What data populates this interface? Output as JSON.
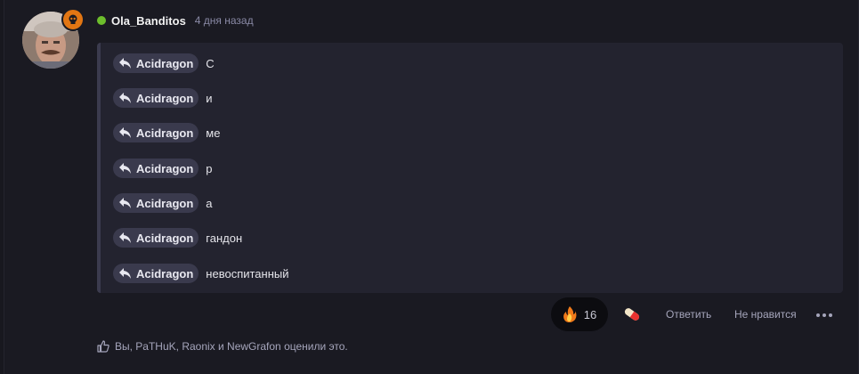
{
  "post": {
    "author": "Ola_Banditos",
    "timestamp": "4 дня назад",
    "online": true,
    "avatar_badge_icon": "skull-icon",
    "accent_badge_color": "#e27613",
    "online_color": "#6dbe2c",
    "quotes": [
      {
        "mention": "Acidragon",
        "text": "С"
      },
      {
        "mention": "Acidragon",
        "text": "и"
      },
      {
        "mention": "Acidragon",
        "text": "ме"
      },
      {
        "mention": "Acidragon",
        "text": "р"
      },
      {
        "mention": "Acidragon",
        "text": "а"
      },
      {
        "mention": "Acidragon",
        "text": "гандон"
      },
      {
        "mention": "Acidragon",
        "text": "невоспитанный"
      }
    ]
  },
  "actions": {
    "reaction_icon": "fire-icon",
    "reaction_count": "16",
    "pill_icon": "pill-icon",
    "reply_label": "Ответить",
    "dislike_label": "Не нравится",
    "more_icon": "more-icon"
  },
  "likes": {
    "icon": "thumbs-up-icon",
    "text": "Вы, PaTHuK, Raonix и NewGrafon оценили это."
  }
}
